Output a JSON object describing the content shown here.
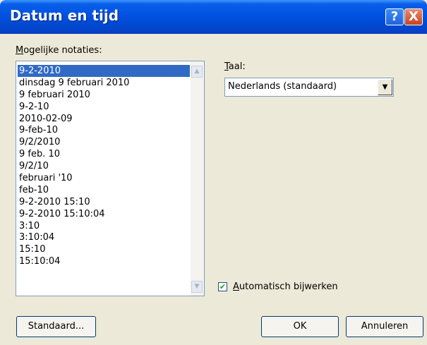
{
  "window": {
    "title": "Datum en tijd",
    "help_button": "?",
    "close_button": "X"
  },
  "formats": {
    "label": "Mogelijke notaties:",
    "selected_index": 0,
    "items": [
      "9-2-2010",
      "dinsdag 9 februari 2010",
      "9 februari 2010",
      "9-2-10",
      "2010-02-09",
      "9-feb-10",
      "9/2/2010",
      "9 feb. 10",
      "9/2/10",
      "februari '10",
      "feb-10",
      "9-2-2010 15:10",
      "9-2-2010 15:10:04",
      "3:10",
      "3:10:04",
      "15:10",
      "15:10:04"
    ]
  },
  "language": {
    "label": "Taal:",
    "value": "Nederlands (standaard)"
  },
  "auto_update": {
    "label": "Automatisch bijwerken",
    "checked": true
  },
  "buttons": {
    "default": "Standaard...",
    "ok": "OK",
    "cancel": "Annuleren"
  }
}
